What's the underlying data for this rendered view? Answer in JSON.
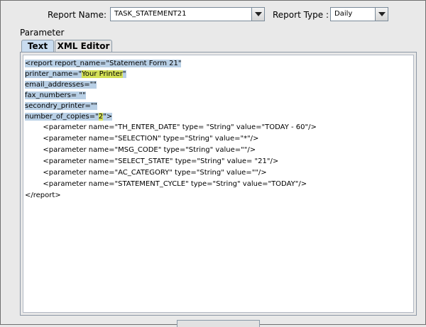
{
  "header": {
    "report_name_label": "Report Name:",
    "report_name_value": "TASK_STATEMENT21",
    "report_type_label": "Report Type :",
    "report_type_value": "Daily"
  },
  "parameter_label": "Parameter",
  "tabs": [
    {
      "label": "Text",
      "active": true
    },
    {
      "label": "XML Editor",
      "active": false
    }
  ],
  "editor": {
    "line_1": "<report report_name=\"Statement Form 21\"",
    "line_2_prefix": "printer_name=\"",
    "line_2_value": "Your Printer",
    "line_2_suffix": "\"",
    "line_3": "email_addresses=\"\"",
    "line_4": "fax_numbers= \"\"",
    "line_5": "secondry_printer=\"\"",
    "line_6_prefix": "number_of_copies=\"",
    "line_6_value": "2",
    "line_6_suffix": "\">",
    "params": [
      "        <parameter name=\"TH_ENTER_DATE\" type= \"String\" value=\"TODAY - 60\"/>",
      "        <parameter name=\"SELECTION\" type=\"String\" value=\"*\"/>",
      "        <parameter name=\"MSG_CODE\" type=\"String\" value=\"\"/>",
      "        <parameter name=\"SELECT_STATE\" type=\"String\" value= \"21\"/>",
      "        <parameter name=\"AC_CATEGORY\" type=\"String\" value=\"\"/>",
      "        <parameter name=\"STATEMENT_CYCLE\" type=\"String\" value=\"TODAY\"/>"
    ],
    "closing": "</report>"
  },
  "colors": {
    "selection": "#b8cfe5",
    "highlight": "#d4e157",
    "active_tab": "#c9dcef"
  }
}
